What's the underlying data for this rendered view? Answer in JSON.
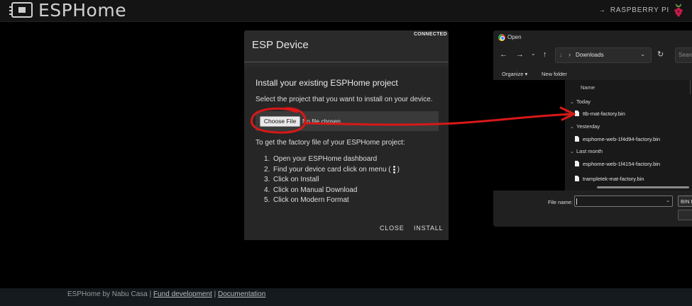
{
  "header": {
    "brand": "ESPHome",
    "target_label": "RASPBERRY PI",
    "target_arrow": "→",
    "logo_icon": "esphome-chip-logo-icon",
    "target_icon": "raspberry-pi-icon"
  },
  "dialog": {
    "title": "ESP Device",
    "status": "CONNECTED",
    "heading": "Install your existing ESPHome project",
    "select_text": "Select the project that you want to install on your device.",
    "choose_file_label": "Choose File",
    "no_file_text": "No file chosen",
    "factory_text": "To get the factory file of your ESPHome project:",
    "steps": [
      {
        "num": "1.",
        "text": "Open your ESPHome dashboard"
      },
      {
        "num": "2.",
        "text": "Find your device card click on menu ("
      },
      {
        "num": "3.",
        "text": "Click on Install"
      },
      {
        "num": "4.",
        "text": "Click on Manual Download"
      },
      {
        "num": "5.",
        "text": "Click on Modern Format"
      }
    ],
    "step2_suffix": ")",
    "close_label": "CLOSE",
    "install_label": "INSTALL"
  },
  "file_dialog": {
    "title": "Open",
    "location": "Downloads",
    "search_placeholder": "Searc",
    "toolbar": {
      "organize": "Organize ▾",
      "new_folder": "New folder"
    },
    "column_name": "Name",
    "groups": [
      {
        "label": "Today",
        "files": [
          "ttb-mat-factory.bin"
        ]
      },
      {
        "label": "Yesterday",
        "files": [
          "esphome-web-1f4d94-factory.bin"
        ]
      },
      {
        "label": "Last month",
        "files": [
          "esphome-web-1f4154-factory.bin",
          "trampletek-mat-factory.bin"
        ]
      }
    ],
    "file_name_label": "File name:",
    "file_type": "BIN F"
  },
  "footer": {
    "prefix": "ESPHome by Nabu Casa |",
    "fund_link": "Fund development",
    "sep": "|",
    "docs_link": "Documentation"
  },
  "colors": {
    "annotation": "#d81818",
    "dialog_bg": "#2a2a2a",
    "downloads_icon": "#4ea84e"
  }
}
